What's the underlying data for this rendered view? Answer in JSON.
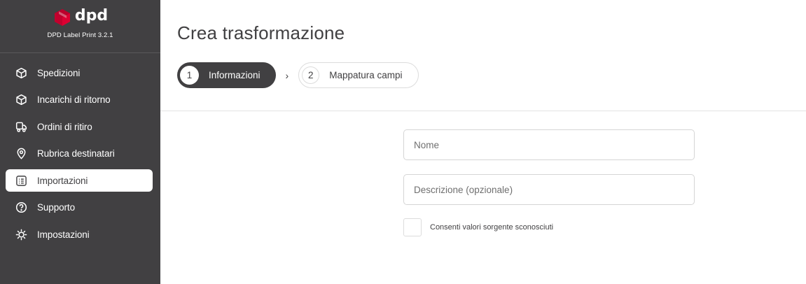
{
  "brand": {
    "logo_text": "dpd",
    "version": "DPD Label Print 3.2.1",
    "accent_color": "#dc0032"
  },
  "sidebar": {
    "items": [
      {
        "label": "Spedizioni",
        "icon": "box-icon",
        "active": false
      },
      {
        "label": "Incarichi di ritorno",
        "icon": "box-return-icon",
        "active": false
      },
      {
        "label": "Ordini di ritiro",
        "icon": "truck-icon",
        "active": false
      },
      {
        "label": "Rubrica destinatari",
        "icon": "location-pin-icon",
        "active": false
      },
      {
        "label": "Importazioni",
        "icon": "list-icon",
        "active": true
      },
      {
        "label": "Supporto",
        "icon": "help-icon",
        "active": false
      },
      {
        "label": "Impostazioni",
        "icon": "gear-icon",
        "active": false
      }
    ]
  },
  "main": {
    "title": "Crea trasformazione",
    "steps": [
      {
        "number": "1",
        "label": "Informazioni",
        "active": true
      },
      {
        "number": "2",
        "label": "Mappatura campi",
        "active": false
      }
    ],
    "step_separator": "›",
    "form": {
      "name_placeholder": "Nome",
      "description_placeholder": "Descrizione (opzionale)",
      "checkbox_label": "Consenti valori sorgente sconosciuti",
      "checkbox_checked": false
    }
  }
}
